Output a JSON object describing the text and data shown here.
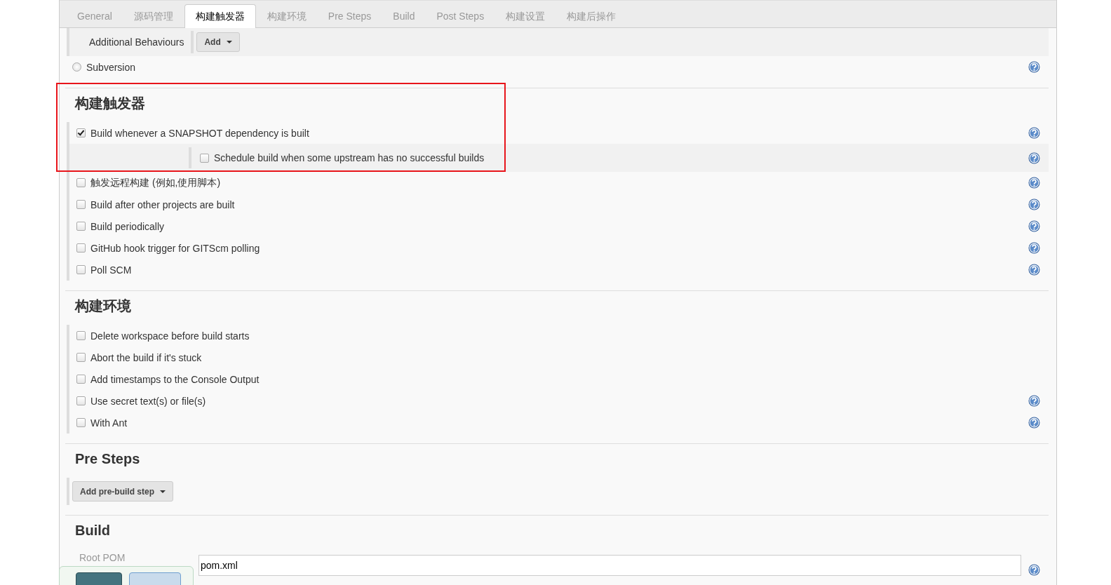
{
  "tabs": [
    {
      "label": "General",
      "selected": false
    },
    {
      "label": "源码管理",
      "selected": false
    },
    {
      "label": "构建触发器",
      "selected": true
    },
    {
      "label": "构建环境",
      "selected": false
    },
    {
      "label": "Pre Steps",
      "selected": false
    },
    {
      "label": "Build",
      "selected": false
    },
    {
      "label": "Post Steps",
      "selected": false
    },
    {
      "label": "构建设置",
      "selected": false
    },
    {
      "label": "构建后操作",
      "selected": false
    }
  ],
  "scm": {
    "additional_behaviours": {
      "label": "Additional Behaviours",
      "button": "Add"
    },
    "options": [
      {
        "label": "Subversion",
        "selected": false,
        "help": true
      }
    ]
  },
  "sections": [
    {
      "title": "构建触发器",
      "highlighted": true,
      "items": [
        {
          "kind": "checkbox",
          "label": "Build whenever a SNAPSHOT dependency is built",
          "checked": true,
          "help": true,
          "children": [
            {
              "kind": "checkbox",
              "label": "Schedule build when some upstream has no successful builds",
              "checked": false,
              "help": true
            }
          ]
        },
        {
          "kind": "checkbox",
          "label": "触发远程构建 (例如,使用脚本)",
          "checked": false,
          "help": true
        },
        {
          "kind": "checkbox",
          "label": "Build after other projects are built",
          "checked": false,
          "help": true
        },
        {
          "kind": "checkbox",
          "label": "Build periodically",
          "checked": false,
          "help": true
        },
        {
          "kind": "checkbox",
          "label": "GitHub hook trigger for GITScm polling",
          "checked": false,
          "help": true
        },
        {
          "kind": "checkbox",
          "label": "Poll SCM",
          "checked": false,
          "help": true
        }
      ]
    },
    {
      "title": "构建环境",
      "highlighted": false,
      "items": [
        {
          "kind": "checkbox",
          "label": "Delete workspace before build starts",
          "checked": false,
          "help": false
        },
        {
          "kind": "checkbox",
          "label": "Abort the build if it's stuck",
          "checked": false,
          "help": false
        },
        {
          "kind": "checkbox",
          "label": "Add timestamps to the Console Output",
          "checked": false,
          "help": false
        },
        {
          "kind": "checkbox",
          "label": "Use secret text(s) or file(s)",
          "checked": false,
          "help": true
        },
        {
          "kind": "checkbox",
          "label": "With Ant",
          "checked": false,
          "help": true
        }
      ]
    },
    {
      "title": "Pre Steps",
      "highlighted": false,
      "items": [
        {
          "kind": "dropdown-button",
          "label": "Add pre-build step"
        }
      ]
    },
    {
      "title": "Build",
      "highlighted": false,
      "items": [
        {
          "kind": "field",
          "label": "Root POM",
          "value": "pom.xml",
          "help": true,
          "popup": true
        }
      ]
    }
  ]
}
